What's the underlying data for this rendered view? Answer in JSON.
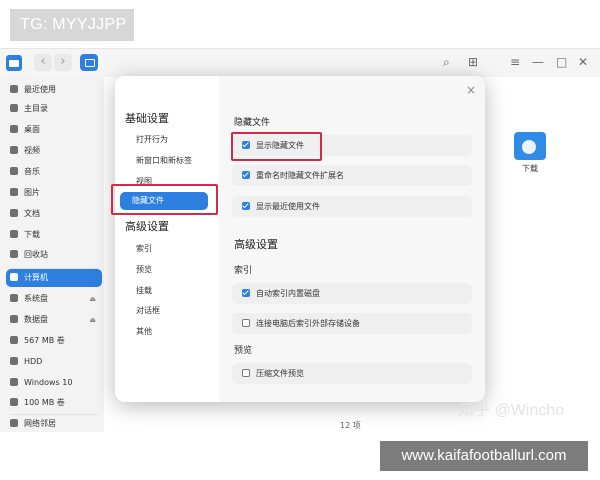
{
  "watermarks": {
    "tg": "TG: MYYJJPP",
    "url": "www.kaifafootballurl.com",
    "zhihu": "知乎 @Wincho"
  },
  "toolbar": {
    "back": "‹",
    "forward": "›",
    "search_icon": "search-icon",
    "menu_icon": "≡",
    "minimize": "—",
    "maximize": "□",
    "close": "✕"
  },
  "sidebar": {
    "items": [
      {
        "label": "最近使用",
        "icon": "clock-icon"
      },
      {
        "label": "主目录",
        "icon": "home-icon"
      },
      {
        "label": "桌面",
        "icon": "desktop-icon"
      },
      {
        "label": "视频",
        "icon": "video-icon"
      },
      {
        "label": "音乐",
        "icon": "music-icon"
      },
      {
        "label": "图片",
        "icon": "image-icon"
      },
      {
        "label": "文档",
        "icon": "document-icon"
      },
      {
        "label": "下载",
        "icon": "download-icon"
      },
      {
        "label": "回收站",
        "icon": "trash-icon"
      }
    ],
    "devices": [
      {
        "label": "计算机",
        "icon": "computer-icon",
        "active": true
      },
      {
        "label": "系统盘",
        "icon": "disk-icon"
      },
      {
        "label": "数据盘",
        "icon": "disk-icon"
      },
      {
        "label": "567 MB 卷",
        "icon": "disk-icon"
      },
      {
        "label": "HDD",
        "icon": "disk-icon"
      },
      {
        "label": "Windows 10",
        "icon": "disk-icon"
      },
      {
        "label": "100 MB 卷",
        "icon": "disk-icon"
      }
    ],
    "network": {
      "label": "网络邻居",
      "icon": "network-icon"
    }
  },
  "content": {
    "folder_label": "下载",
    "item_count": "12 项"
  },
  "dialog": {
    "close": "×",
    "nav": {
      "group_basic": "基础设置",
      "open_behavior": "打开行为",
      "new_window_tab": "新窗口和新标签",
      "view": "视图",
      "hidden_files": "隐藏文件",
      "group_advanced": "高级设置",
      "index": "索引",
      "preview": "预览",
      "mount": "挂载",
      "dialog": "对话框",
      "other": "其他"
    },
    "section_hidden": "隐藏文件",
    "opt_show_hidden": "显示隐藏文件",
    "opt_hide_ext_on_rename": "重命名时隐藏文件扩展名",
    "opt_show_recent": "显示最近使用文件",
    "section_advanced": "高级设置",
    "sub_index": "索引",
    "opt_auto_index_internal": "自动索引内置磁盘",
    "opt_index_external": "连接电脑后索引外部存储设备",
    "sub_preview": "预览",
    "opt_compress_preview": "压缩文件预览",
    "checked": {
      "show_hidden": true,
      "hide_ext_on_rename": true,
      "show_recent": true,
      "auto_index_internal": true,
      "index_external": false,
      "compress_preview": false
    }
  }
}
